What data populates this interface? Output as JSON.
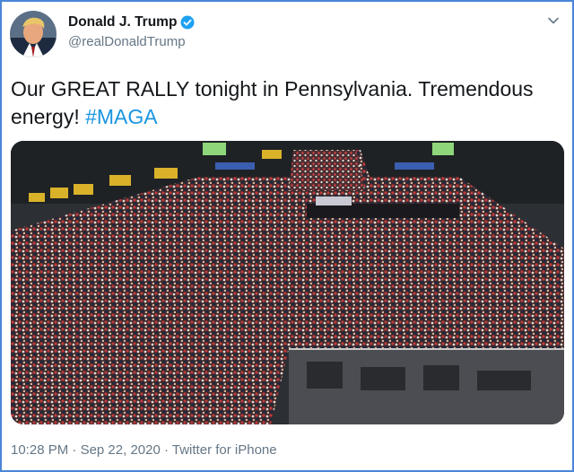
{
  "author": {
    "display_name": "Donald J. Trump",
    "handle": "@realDonaldTrump",
    "verified": true,
    "avatar_icon": "profile-photo"
  },
  "tweet": {
    "text_main": "Our GREAT RALLY tonight in Pennsylvania. Tremendous energy!",
    "hashtag": "#MAGA"
  },
  "meta": {
    "time": "10:28 PM",
    "date": "Sep 22, 2020",
    "source": "Twitter for iPhone",
    "separator": "·"
  },
  "media": {
    "description_icon": "rally-crowd-photo"
  },
  "colors": {
    "border": "#4a86d8",
    "link": "#1b95e0",
    "verified": "#1da1f2",
    "muted": "#657786",
    "text": "#14171a"
  }
}
